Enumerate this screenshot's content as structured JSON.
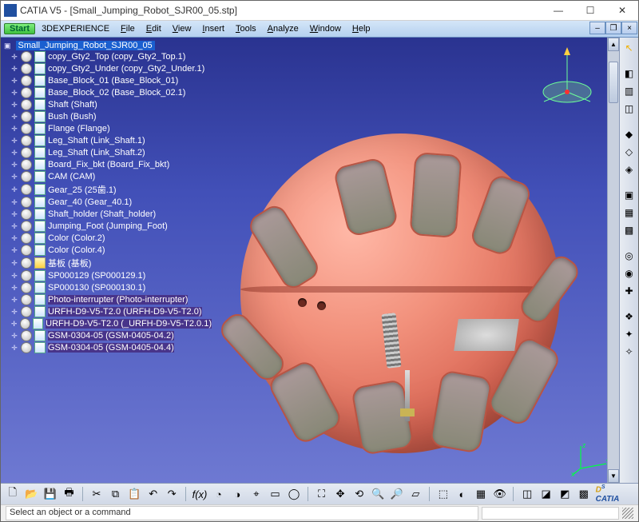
{
  "title": "CATIA V5 - [Small_Jumping_Robot_SJR00_05.stp]",
  "menu": {
    "start": "Start",
    "items": [
      "3DEXPERIENCE",
      "File",
      "Edit",
      "View",
      "Insert",
      "Tools",
      "Analyze",
      "Window",
      "Help"
    ]
  },
  "tree": {
    "root": "Small_Jumping_Robot_SJR00_05",
    "items": [
      {
        "label": "copy_Gty2_Top (copy_Gty2_Top.1)"
      },
      {
        "label": "copy_Gty2_Under (copy_Gty2_Under.1)"
      },
      {
        "label": "Base_Block_01 (Base_Block_01)"
      },
      {
        "label": "Base_Block_02 (Base_Block_02.1)"
      },
      {
        "label": "Shaft (Shaft)"
      },
      {
        "label": "Bush (Bush)"
      },
      {
        "label": "Flange (Flange)"
      },
      {
        "label": "Leg_Shaft (Link_Shaft.1)"
      },
      {
        "label": "Leg_Shaft (Link_Shaft.2)"
      },
      {
        "label": "Board_Fix_bkt (Board_Fix_bkt)"
      },
      {
        "label": "CAM (CAM)"
      },
      {
        "label": "Gear_25 (25歯.1)"
      },
      {
        "label": "Gear_40 (Gear_40.1)"
      },
      {
        "label": "Shaft_holder (Shaft_holder)"
      },
      {
        "label": "Jumping_Foot (Jumping_Foot)"
      },
      {
        "label": "Color (Color.2)"
      },
      {
        "label": "Color (Color.4)"
      },
      {
        "label": "基板 (基板)",
        "yellow": true
      },
      {
        "label": "SP000129 (SP000129.1)"
      },
      {
        "label": "SP000130 (SP000130.1)"
      },
      {
        "label": "Photo-interrupter (Photo-interrupter)",
        "hl": true
      },
      {
        "label": "URFH-D9-V5-T2.0 (URFH-D9-V5-T2.0)",
        "hl": true
      },
      {
        "label": "URFH-D9-V5-T2.0 (_URFH-D9-V5-T2.0.1)",
        "hl": true
      },
      {
        "label": "GSM-0304-05 (GSM-0405-04.2)",
        "hl": true
      },
      {
        "label": "GSM-0304-05 (GSM-0405-04.4)",
        "hl": true
      }
    ]
  },
  "status": {
    "prompt": "Select an object or a command"
  },
  "axes": {
    "x": "x",
    "y": "y",
    "z": "z"
  },
  "logo": "CATIA"
}
